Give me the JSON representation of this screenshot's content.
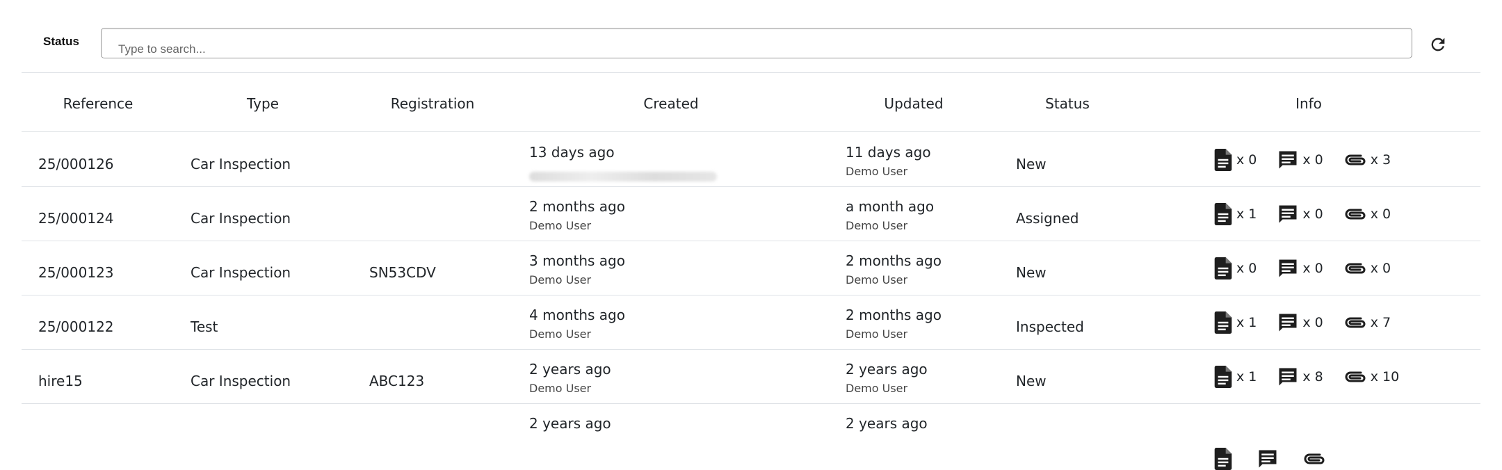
{
  "filter": {
    "label": "Status",
    "search_placeholder": "Type to search..."
  },
  "table": {
    "columns": [
      "Reference",
      "Type",
      "Registration",
      "Created",
      "Updated",
      "Status",
      "Info"
    ],
    "rows": [
      {
        "reference": "25/000126",
        "type": "Car Inspection",
        "registration": "",
        "created": "13 days ago",
        "created_by": "",
        "created_by_redacted": true,
        "updated": "11 days ago",
        "updated_by": "Demo User",
        "status": "New",
        "docs": "x 0",
        "comments": "x 0",
        "attachments": "x 3"
      },
      {
        "reference": "25/000124",
        "type": "Car Inspection",
        "registration": "",
        "created": "2 months ago",
        "created_by": "Demo User",
        "updated": "a month ago",
        "updated_by": "Demo User",
        "status": "Assigned",
        "docs": "x 1",
        "comments": "x 0",
        "attachments": "x 0"
      },
      {
        "reference": "25/000123",
        "type": "Car Inspection",
        "registration": "SN53CDV",
        "created": "3 months ago",
        "created_by": "Demo User",
        "updated": "2 months ago",
        "updated_by": "Demo User",
        "status": "New",
        "docs": "x 0",
        "comments": "x 0",
        "attachments": "x 0"
      },
      {
        "reference": "25/000122",
        "type": "Test",
        "registration": "",
        "created": "4 months ago",
        "created_by": "Demo User",
        "updated": "2 months ago",
        "updated_by": "Demo User",
        "status": "Inspected",
        "docs": "x 1",
        "comments": "x 0",
        "attachments": "x 7"
      },
      {
        "reference": "hire15",
        "type": "Car Inspection",
        "registration": "ABC123",
        "created": "2 years ago",
        "created_by": "Demo User",
        "updated": "2 years ago",
        "updated_by": "Demo User",
        "status": "New",
        "docs": "x 1",
        "comments": "x 8",
        "attachments": "x 10"
      },
      {
        "reference": "",
        "type": "",
        "registration": "",
        "created": "2 years ago",
        "created_by": "",
        "updated": "2 years ago",
        "updated_by": "",
        "status": "",
        "docs": "",
        "comments": "",
        "attachments": ""
      }
    ]
  },
  "icons": {
    "refresh": "refresh-icon",
    "docs": "document-icon",
    "comments": "comment-icon",
    "attachments": "paperclip-icon"
  }
}
